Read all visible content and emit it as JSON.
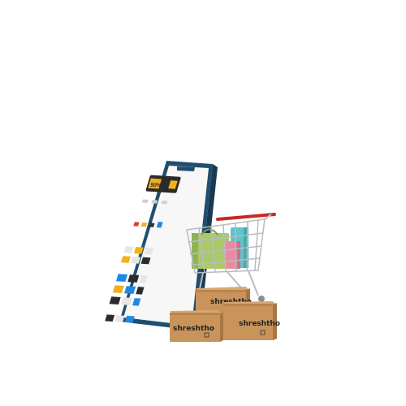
{
  "boxes": [
    {
      "brand": "shreshtho"
    },
    {
      "brand": "shreshtho"
    },
    {
      "brand": "shreshtho"
    }
  ],
  "phone_screen": {
    "banner_text": "50%"
  },
  "colors": {
    "background": "#ffffff",
    "phone_frame": "#1f4e6e",
    "cardboard": "#c9945a",
    "cardboard_dark": "#a87544",
    "cart_metal": "#b8bcc2",
    "cart_handle": "#c62828",
    "bag_green": "#a9c96a",
    "bag_teal": "#5fc4c9",
    "bag_pink": "#e98aa0",
    "banner_yellow": "#f2b01e"
  },
  "icons": [
    "smartphone-icon",
    "shopping-cart-icon",
    "shopping-bag-icon",
    "cardboard-box-icon"
  ]
}
